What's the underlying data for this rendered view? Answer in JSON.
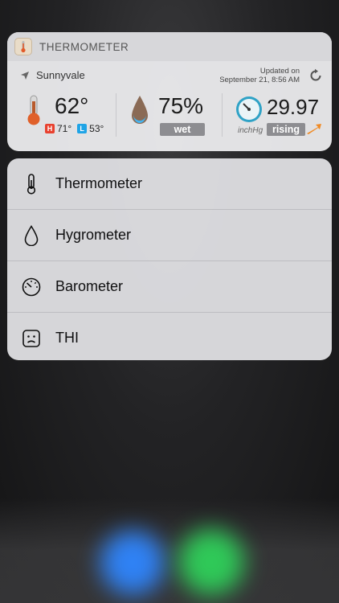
{
  "widget": {
    "app_title": "THERMOMETER",
    "location": "Sunnyvale",
    "updated_line1": "Updated on",
    "updated_line2": "September 21, 8:56 AM",
    "temperature": "62°",
    "high_label": "H",
    "high_value": "71°",
    "low_label": "L",
    "low_value": "53°",
    "humidity": "75%",
    "humidity_status": "wet",
    "pressure": "29.97",
    "pressure_unit": "inchHg",
    "pressure_trend": "rising",
    "colors": {
      "high": "#e8412f",
      "low": "#1fa4e6",
      "trend_arrow": "#f08a24"
    }
  },
  "menu": {
    "items": [
      {
        "label": "Thermometer",
        "icon": "thermometer-icon"
      },
      {
        "label": "Hygrometer",
        "icon": "droplet-icon"
      },
      {
        "label": "Barometer",
        "icon": "gauge-icon"
      },
      {
        "label": "THI",
        "icon": "face-icon"
      }
    ]
  }
}
